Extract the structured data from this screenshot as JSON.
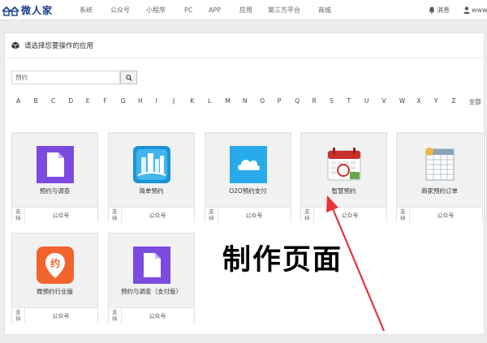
{
  "brand": {
    "name": "微人家",
    "logo_icon": "house-logo-icon",
    "color": "#1d3f8a"
  },
  "nav": {
    "items": [
      "系统",
      "公众号",
      "小程序",
      "PC",
      "APP",
      "应用",
      "第三方平台",
      "商城"
    ]
  },
  "user_bar": {
    "messages_label": "消息",
    "username": "www",
    "bell_icon": "bell-icon",
    "user_icon": "user-icon"
  },
  "panel": {
    "title": "请选择您要操作的应用",
    "title_icon": "cube-icon"
  },
  "search": {
    "value": "预约",
    "button_icon": "search-icon"
  },
  "letters": [
    "A",
    "B",
    "C",
    "D",
    "E",
    "F",
    "G",
    "H",
    "I",
    "J",
    "K",
    "L",
    "M",
    "N",
    "O",
    "P",
    "Q",
    "R",
    "S",
    "T",
    "U",
    "V",
    "W",
    "X",
    "Y",
    "Z",
    "全部"
  ],
  "apps": [
    {
      "name": "预约与调查",
      "support": "支持",
      "type": "公众号",
      "icon": "document-icon",
      "color": "#7b4be0"
    },
    {
      "name": "简单预约",
      "support": "支持",
      "type": "公众号",
      "icon": "city-icon",
      "color": "#2fa7e0"
    },
    {
      "name": "O2O预约支付",
      "support": "支持",
      "type": "公众号",
      "icon": "cloud-icon",
      "color": "#29aaea"
    },
    {
      "name": "智慧预约",
      "support": "支持",
      "type": "公众号",
      "icon": "calendar-icon",
      "color": "#c9302c"
    },
    {
      "name": "商家预约订单",
      "support": "支持",
      "type": "公众号",
      "icon": "spreadsheet-icon",
      "color": "#8aa3b8"
    },
    {
      "name": "微预约行业版",
      "support": "支持",
      "type": "公众号",
      "icon": "location-pin-icon",
      "color": "#f2642e"
    },
    {
      "name": "预约与调查（支付版）",
      "support": "支持",
      "type": "公众号",
      "icon": "document-icon",
      "color": "#7b4be0"
    }
  ],
  "annotation": {
    "text": "制作页面",
    "color": "#e8333a"
  }
}
